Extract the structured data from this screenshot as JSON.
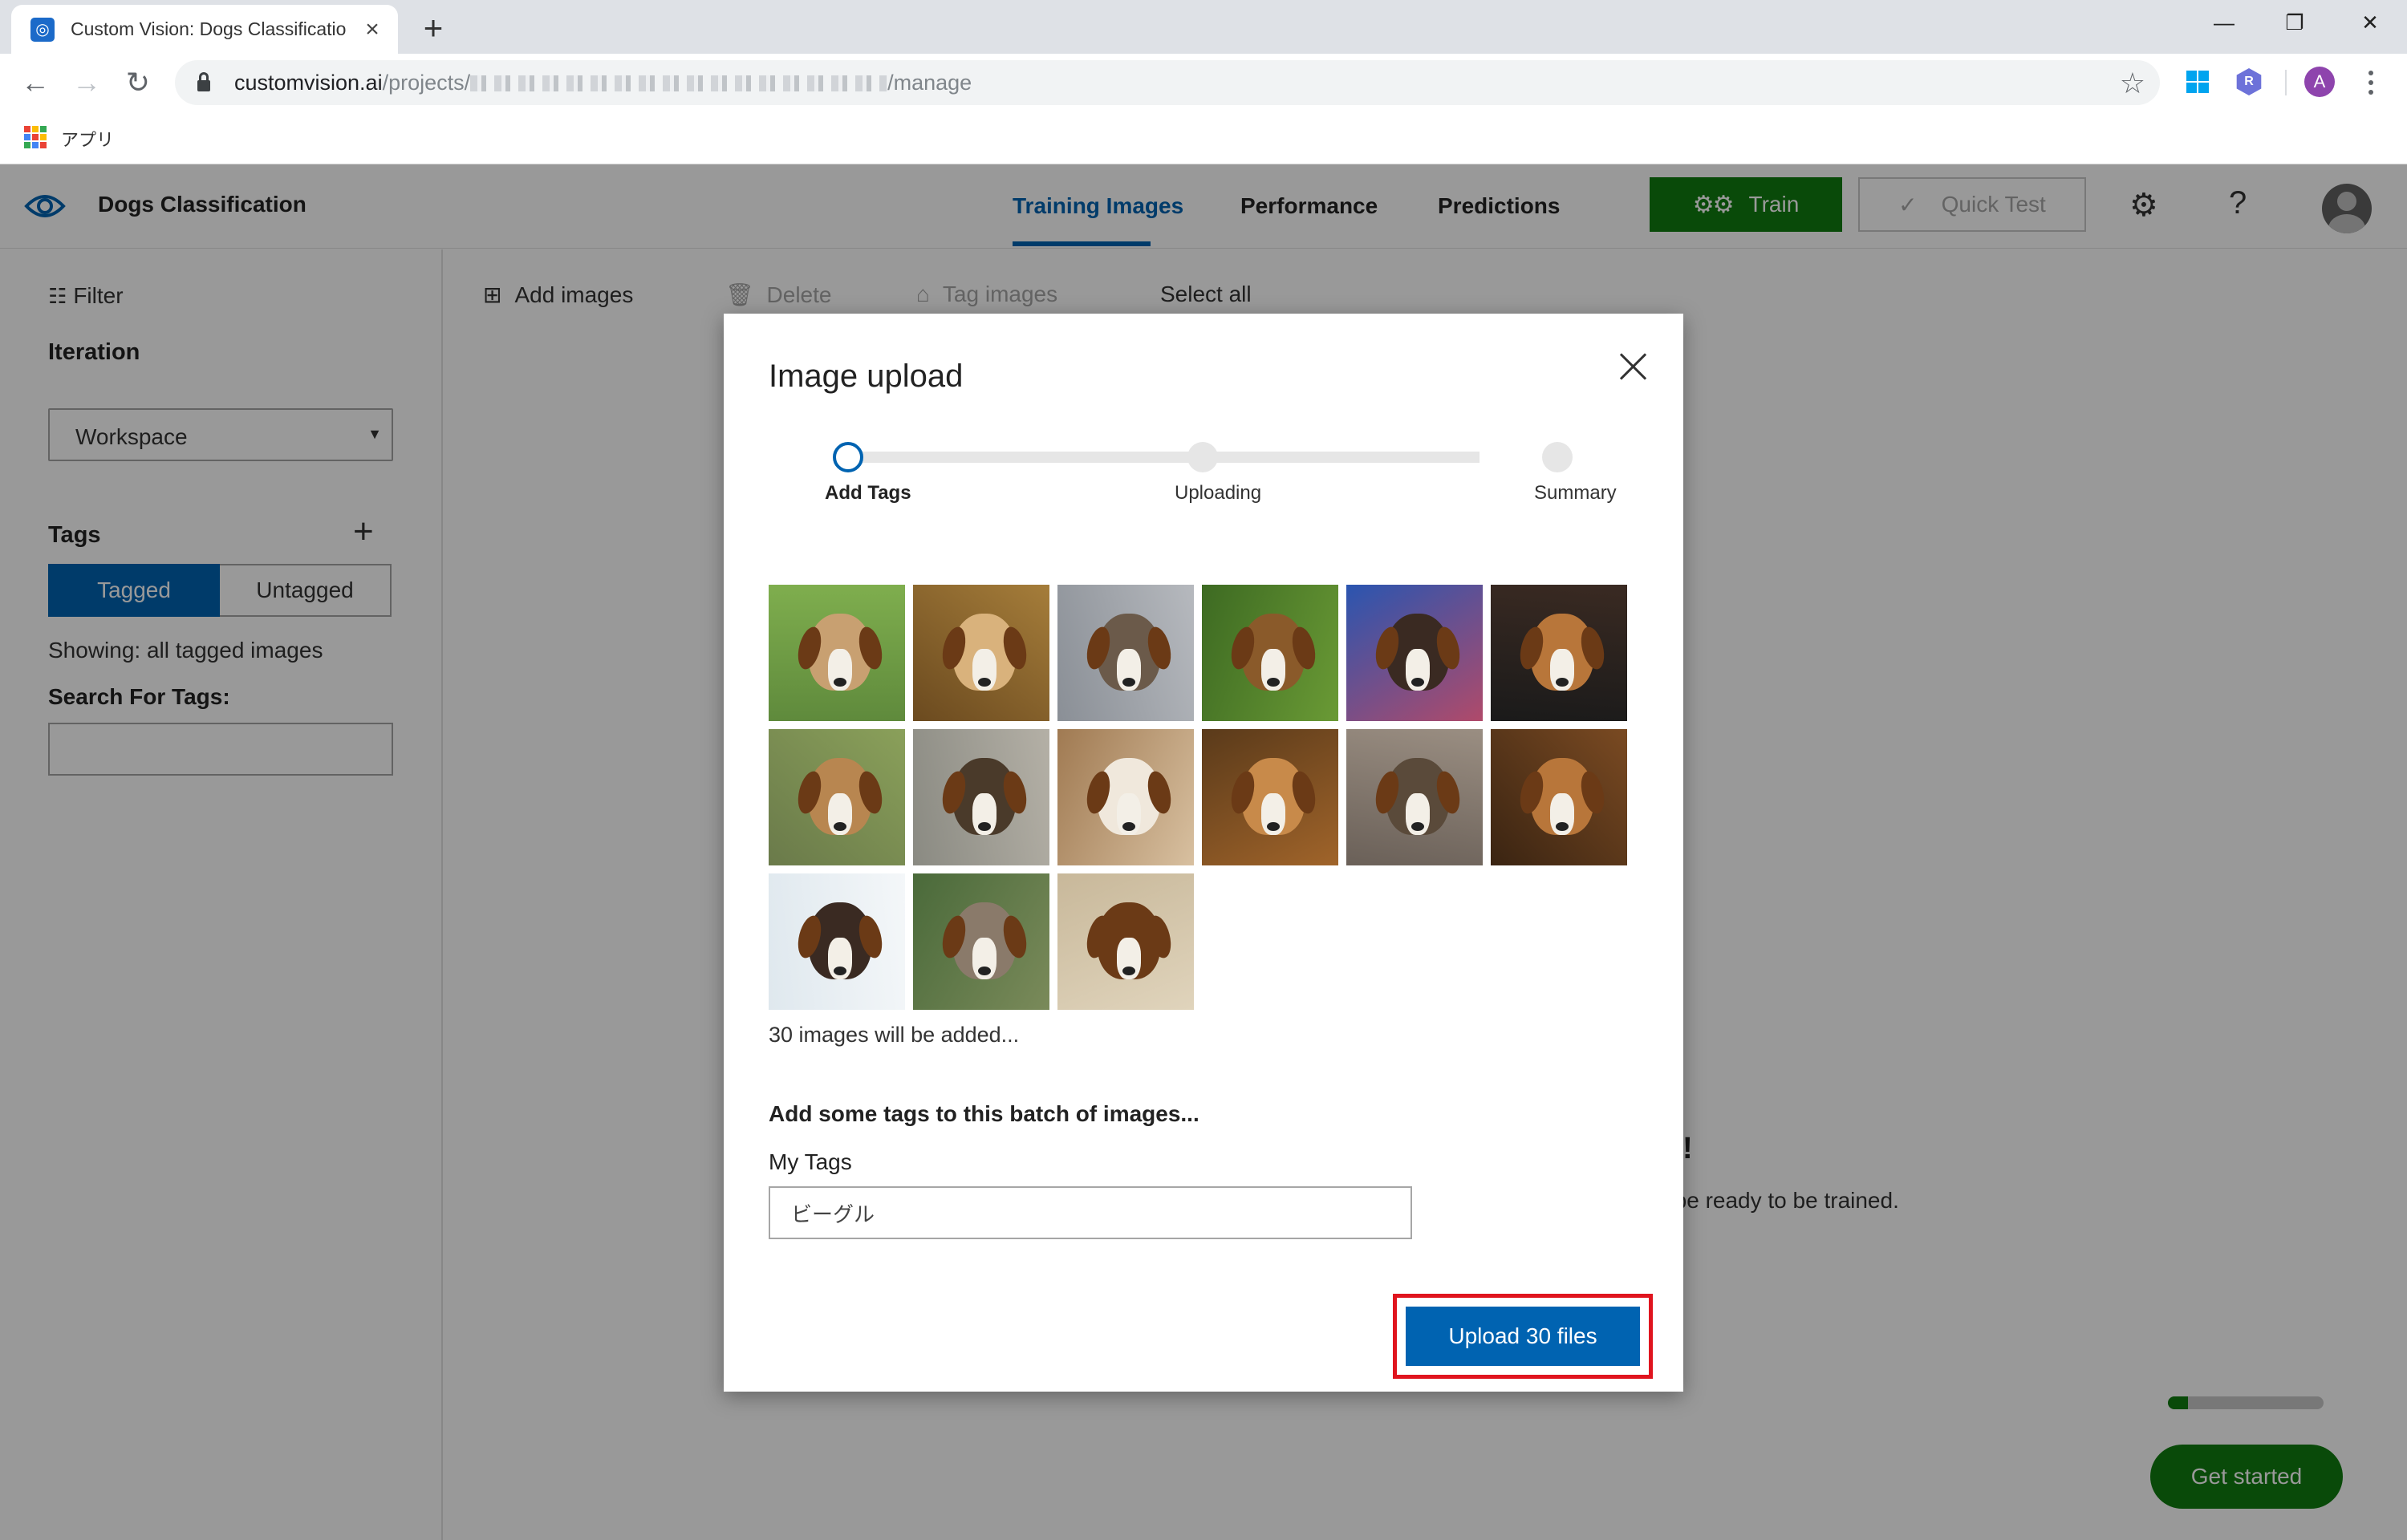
{
  "browser": {
    "tab_title": "Custom Vision: Dogs Classificatio",
    "tab_favicon": "custom-vision-icon",
    "url_host": "customvision.ai",
    "url_path_prefix": "/projects/",
    "url_path_suffix": "/manage",
    "bookmark_apps_label": "アプリ",
    "profile_initial": "A",
    "extension_r": "R"
  },
  "app": {
    "project_name": "Dogs Classification",
    "nav_tabs": [
      "Training Images",
      "Performance",
      "Predictions"
    ],
    "active_tab": "Training Images",
    "train_label": "Train",
    "quick_test_label": "Quick Test",
    "accent_color": "#0063b1",
    "train_color": "#107c10"
  },
  "sidebar": {
    "filter_label": "Filter",
    "iteration_heading": "Iteration",
    "iteration_value": "Workspace",
    "tags_heading": "Tags",
    "tagged_label": "Tagged",
    "untagged_label": "Untagged",
    "showing_text": "Showing: all tagged images",
    "search_label": "Search For Tags:",
    "search_value": ""
  },
  "commands": {
    "add_images": "Add images",
    "delete": "Delete",
    "tag_images": "Tag images",
    "select_all": "Select all"
  },
  "background": {
    "empty_heading_visible": "ere!",
    "empty_text_visible": "will be ready to be trained.",
    "get_started": "Get started",
    "progress_fraction": 0.13
  },
  "modal": {
    "title": "Image upload",
    "steps": [
      {
        "label": "Add Tags",
        "state": "active"
      },
      {
        "label": "Uploading",
        "state": "todo"
      },
      {
        "label": "Summary",
        "state": "todo"
      }
    ],
    "thumbnail_count_shown": 15,
    "count_text": "30 images will be added...",
    "tags_prompt": "Add some tags to this batch of images...",
    "my_tags_label": "My Tags",
    "my_tags_value": "ビーグル",
    "upload_button": "Upload 30 files",
    "highlight_color": "#e0141e"
  }
}
